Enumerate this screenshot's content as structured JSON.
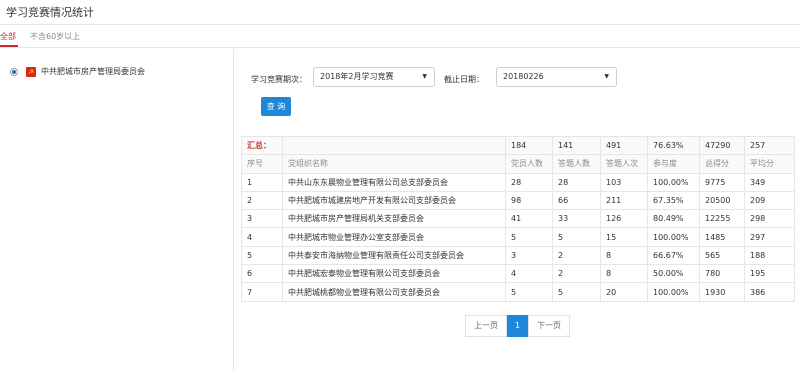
{
  "page_title": "学习竞赛情况统计",
  "tabs": [
    {
      "label": "全部",
      "active": true
    },
    {
      "label": "不含60岁以上",
      "active": false
    }
  ],
  "sidebar": {
    "tree": [
      {
        "label": "中共肥城市房产管理局委员会",
        "selected": true,
        "icon": "party-flag-icon"
      }
    ]
  },
  "filters": {
    "period_label": "学习竞赛期次：",
    "period_value": "2018年2月学习竞赛",
    "deadline_label": "截止日期：",
    "deadline_value": "20180226",
    "query_label": "查 询"
  },
  "table": {
    "summary": {
      "label": "汇总：",
      "members": "184",
      "answered": "141",
      "attempts": "491",
      "participation": "76.63%",
      "total_score": "47290",
      "avg_score": "257"
    },
    "headers": [
      "序号",
      "党组织名称",
      "党员人数",
      "答题人数",
      "答题人次",
      "参与度",
      "总得分",
      "平均分"
    ],
    "rows": [
      [
        "1",
        "中共山东东晨物业管理有限公司总支部委员会",
        "28",
        "28",
        "103",
        "100.00%",
        "9775",
        "349"
      ],
      [
        "2",
        "中共肥城市城建房地产开发有限公司支部委员会",
        "98",
        "66",
        "211",
        "67.35%",
        "20500",
        "209"
      ],
      [
        "3",
        "中共肥城市房产管理局机关支部委员会",
        "41",
        "33",
        "126",
        "80.49%",
        "12255",
        "298"
      ],
      [
        "4",
        "中共肥城市物业管理办公室支部委员会",
        "5",
        "5",
        "15",
        "100.00%",
        "1485",
        "297"
      ],
      [
        "5",
        "中共泰安市海纳物业管理有限责任公司支部委员会",
        "3",
        "2",
        "8",
        "66.67%",
        "565",
        "188"
      ],
      [
        "6",
        "中共肥城宏泰物业管理有限公司支部委员会",
        "4",
        "2",
        "8",
        "50.00%",
        "780",
        "195"
      ],
      [
        "7",
        "中共肥城桃都物业管理有限公司支部委员会",
        "5",
        "5",
        "20",
        "100.00%",
        "1930",
        "386"
      ]
    ]
  },
  "pagination": {
    "prev": "上一页",
    "current": "1",
    "next": "下一页"
  },
  "colors": {
    "accent_red": "#c9302c",
    "primary_blue": "#1e88d8"
  }
}
